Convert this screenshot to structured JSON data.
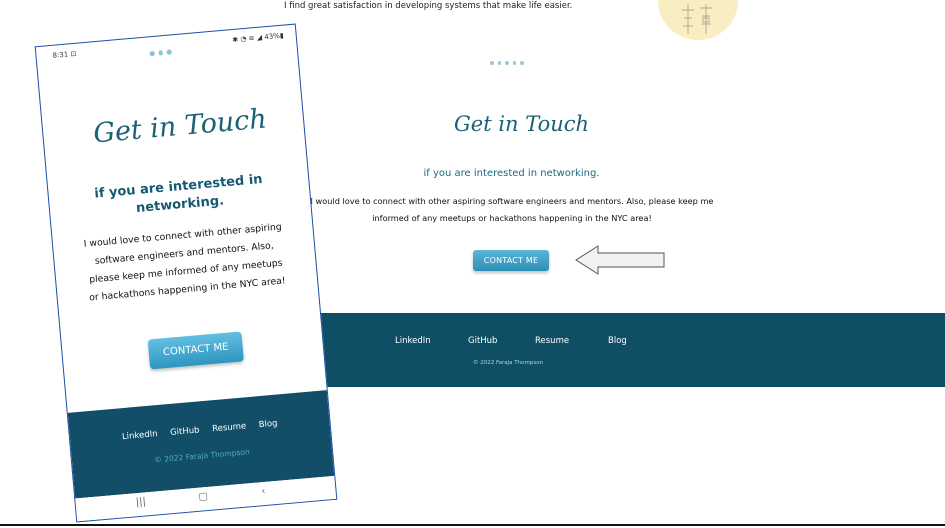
{
  "desktop": {
    "intro_text": "I find great satisfaction in developing systems that make life easier.",
    "title": "Get in Touch",
    "subtitle": "if you are interested in networking.",
    "body_line1": "I would love to connect with other aspiring software engineers and mentors. Also, please keep me",
    "body_line2": "informed of any meetups or hackathons happening in the NYC area!",
    "contact_button": "CONTACT ME",
    "footer": {
      "links": [
        "LinkedIn",
        "GitHub",
        "Resume",
        "Blog"
      ],
      "copyright": "© 2022 Faraja Thompson"
    }
  },
  "phone": {
    "status_time": "8:31",
    "status_battery": "43%",
    "title": "Get in Touch",
    "subtitle_line1": "if you are interested in",
    "subtitle_line2": "networking.",
    "body_lines": [
      "I would love to connect with other aspiring",
      "software engineers and mentors. Also,",
      "please keep me informed of any meetups",
      "or hackathons happening in the NYC area!"
    ],
    "contact_button": "CONTACT ME",
    "footer": {
      "links": [
        "LinkedIn",
        "GitHub",
        "Resume",
        "Blog"
      ],
      "copyright": "© 2022 Faraja Thompson"
    },
    "nav_icons": [
      "recent-apps-icon",
      "home-icon",
      "back-icon"
    ]
  },
  "colors": {
    "footer_bg": "#0f4f66",
    "accent": "#1a6175",
    "button": "#3a9fc6",
    "dots": "#9ec7dc"
  }
}
